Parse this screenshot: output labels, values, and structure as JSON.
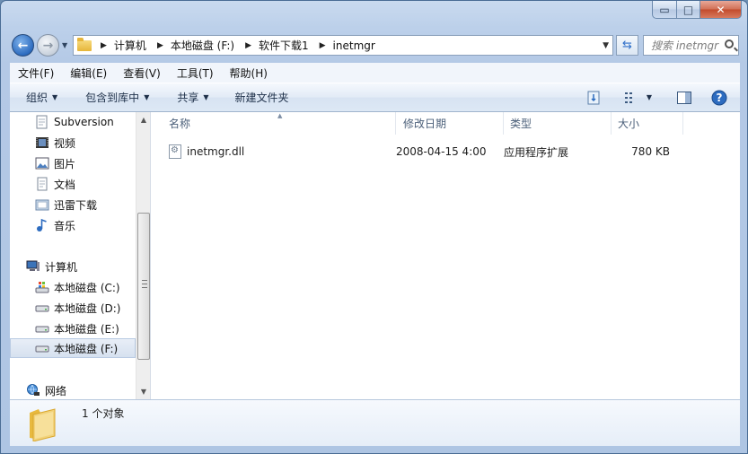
{
  "window": {
    "minimize_glyph": "▭",
    "maximize_glyph": "□",
    "close_glyph": "✕"
  },
  "address": {
    "crumbs": [
      "计算机",
      "本地磁盘 (F:)",
      "软件下载1",
      "inetmgr"
    ]
  },
  "search": {
    "placeholder": "搜索 inetmgr"
  },
  "menu": [
    "文件(F)",
    "编辑(E)",
    "查看(V)",
    "工具(T)",
    "帮助(H)"
  ],
  "toolbar": {
    "organize": "组织",
    "include_in_library": "包含到库中",
    "share": "共享",
    "new_folder": "新建文件夹"
  },
  "nav": {
    "subversion": "Subversion",
    "videos": "视频",
    "pictures": "图片",
    "documents": "文档",
    "xunlei": "迅雷下载",
    "music": "音乐",
    "computer": "计算机",
    "drive_c": "本地磁盘 (C:)",
    "drive_d": "本地磁盘 (D:)",
    "drive_e": "本地磁盘 (E:)",
    "drive_f": "本地磁盘 (F:)",
    "network": "网络"
  },
  "columns": {
    "name": "名称",
    "modified": "修改日期",
    "type": "类型",
    "size": "大小"
  },
  "files": [
    {
      "name": "inetmgr.dll",
      "modified": "2008-04-15 4:00",
      "type": "应用程序扩展",
      "size": "780 KB"
    }
  ],
  "status": {
    "count": "1 个对象"
  },
  "colors": {
    "accent": "#2d6cc0",
    "folder": "#e6b53a"
  }
}
